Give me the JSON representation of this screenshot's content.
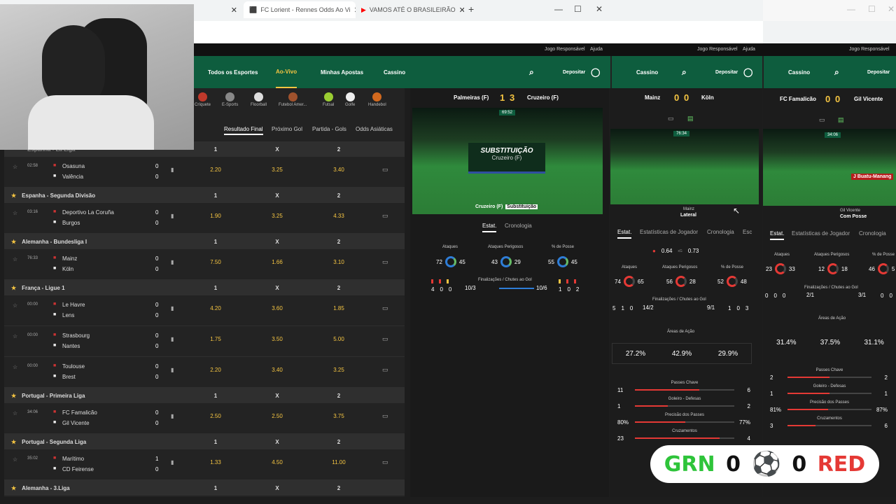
{
  "browser": {
    "tabs": [
      {
        "title": "FC Lorient - Rennes Odds Ao Vi",
        "icon": "betting-site-icon"
      },
      {
        "title": "VAMOS ATÉ O BRASILEIRÃO",
        "icon": "youtube-icon"
      }
    ],
    "new_tab": "+",
    "window_controls": {
      "minimize": "—",
      "maximize": "☐",
      "close": "✕"
    }
  },
  "site": {
    "topbar": [
      "Jogo Responsável",
      "Ajuda"
    ],
    "nav": [
      "Todos os Esportes",
      "Ao-Vivo",
      "Minhas Apostas",
      "Cassino"
    ],
    "deposit": "Depositar",
    "panel2_nav": "Cassino",
    "panel3_nav": "Cassino"
  },
  "sports_bar": [
    "Críquete",
    "E-Sports",
    "Floorball",
    "Futebol Amer...",
    "Futsal",
    "Golfe",
    "Handebol"
  ],
  "market_tabs": [
    "Resultado Final",
    "Próximo Gol",
    "Partida - Gols",
    "Odds Asiáticas"
  ],
  "col_headers": {
    "h": "1",
    "x": "X",
    "a": "2"
  },
  "partial_league": "Espanha - La Liga",
  "rows": [
    {
      "type": "match",
      "time": "02:58",
      "home": "Osasuna",
      "away": "Valência",
      "hs": "0",
      "as": "0",
      "o1": "2.20",
      "ox": "3.25",
      "o2": "3.40"
    },
    {
      "type": "league",
      "name": "Espanha - Segunda Divisão"
    },
    {
      "type": "match",
      "time": "03:16",
      "home": "Deportivo La Coruña",
      "away": "Burgos",
      "hs": "0",
      "as": "0",
      "o1": "1.90",
      "ox": "3.25",
      "o2": "4.33"
    },
    {
      "type": "league",
      "name": "Alemanha - Bundesliga I",
      "star": true
    },
    {
      "type": "match",
      "time": "76:33",
      "home": "Mainz",
      "away": "Köln",
      "hs": "0",
      "as": "0",
      "o1": "7.50",
      "ox": "1.66",
      "o2": "3.10"
    },
    {
      "type": "league",
      "name": "França - Ligue 1",
      "star": true
    },
    {
      "type": "match",
      "time": "00:00",
      "home": "Le Havre",
      "away": "Lens",
      "hs": "0",
      "as": "0",
      "o1": "4.20",
      "ox": "3.60",
      "o2": "1.85"
    },
    {
      "type": "match",
      "time": "00:00",
      "home": "Strasbourg",
      "away": "Nantes",
      "hs": "0",
      "as": "0",
      "o1": "1.75",
      "ox": "3.50",
      "o2": "5.00"
    },
    {
      "type": "match",
      "time": "00:00",
      "home": "Toulouse",
      "away": "Brest",
      "hs": "0",
      "as": "0",
      "o1": "2.20",
      "ox": "3.40",
      "o2": "3.25"
    },
    {
      "type": "league",
      "name": "Portugal - Primeira Liga",
      "star": true
    },
    {
      "type": "match",
      "time": "34:06",
      "home": "FC Famalicão",
      "away": "Gil Vicente",
      "hs": "0",
      "as": "0",
      "o1": "2.50",
      "ox": "2.50",
      "o2": "3.75"
    },
    {
      "type": "league",
      "name": "Portugal - Segunda Liga",
      "star": true
    },
    {
      "type": "match",
      "time": "35:02",
      "home": "Marítimo",
      "away": "CD Feirense",
      "hs": "1",
      "as": "0",
      "o1": "1.33",
      "ox": "4.50",
      "o2": "11.00"
    },
    {
      "type": "league",
      "name": "Alemanha - 3.Liga",
      "star": true
    }
  ],
  "mid": {
    "home": "Palmeiras (F)",
    "away": "Cruzeiro (F)",
    "hs": "1",
    "as": "3",
    "clock": "69:52",
    "event_title": "SUBSTITUIÇÃO",
    "event_team": "Cruzeiro (F)",
    "footer_team": "Cruzeiro (F)",
    "footer_event": "Substituição",
    "tabs": [
      "Estat.",
      "Cronologia"
    ],
    "stat_labels": [
      "Ataques",
      "Ataques Perigosos",
      "% de Posse"
    ],
    "stats": [
      [
        "72",
        "45"
      ],
      [
        "43",
        "29"
      ],
      [
        "55",
        "45"
      ]
    ],
    "shots_label": "Finalizações / Chutes ao Gol",
    "shots": [
      "10/3",
      "10/6"
    ],
    "cards_left": [
      "4",
      "0",
      "0"
    ],
    "cards_right": [
      "1",
      "0",
      "2"
    ]
  },
  "panel2": {
    "home": "Mainz",
    "away": "Köln",
    "hs": "0",
    "as": "0",
    "clock": "76:34",
    "event_team": "Mainz",
    "event_name": "Lateral",
    "tabs": [
      "Estat.",
      "Estatísticas de Jogador",
      "Cronologia",
      "Esc"
    ],
    "xg": [
      "0.64",
      "xG",
      "0.73"
    ],
    "stat_labels": [
      "Ataques",
      "Ataques Perigosos",
      "% de Posse"
    ],
    "stats": [
      [
        "74",
        "65"
      ],
      [
        "56",
        "28"
      ],
      [
        "52",
        "48"
      ]
    ],
    "shots_label": "Finalizações / Chutes ao Gol",
    "shots": [
      "14/2",
      "9/1"
    ],
    "cards_left": [
      "5",
      "1",
      "0"
    ],
    "cards_right": [
      "1",
      "0",
      "3"
    ],
    "areas_label": "Áreas de Ação",
    "areas": [
      "27.2%",
      "42.9%",
      "29.9%"
    ],
    "bars": [
      {
        "label": "Passes Chave",
        "l": "11",
        "r": "6",
        "frac": 0.65
      },
      {
        "label": "Goleiro - Defesas",
        "l": "1",
        "r": "2",
        "frac": 0.33
      },
      {
        "label": "Precisão dos Passes",
        "l": "80%",
        "r": "77%",
        "frac": 0.51
      },
      {
        "label": "Cruzamentos",
        "l": "23",
        "r": "4",
        "frac": 0.85
      }
    ]
  },
  "panel3": {
    "home": "FC Famalicão",
    "away": "Gil Vicente",
    "hs": "0",
    "as": "0",
    "clock": "34:06",
    "event_team": "Gil Vicente",
    "event_name": "Com Posse",
    "player": "J Buatu-Manang",
    "tabs": [
      "Estat.",
      "Estatísticas de Jogador",
      "Cronologia"
    ],
    "stat_labels": [
      "Ataques",
      "Ataques Perigosos",
      "% de Posse"
    ],
    "stats": [
      [
        "23",
        "33"
      ],
      [
        "12",
        "18"
      ],
      [
        "46",
        "5"
      ]
    ],
    "shots_label": "Finalizações / Chutes ao Gol",
    "shots": [
      "2/1",
      "3/1"
    ],
    "cards_left": [
      "0",
      "0",
      "0"
    ],
    "cards_right": [
      "0",
      "0"
    ],
    "areas_label": "Áreas de Ação",
    "areas": [
      "31.4%",
      "37.5%",
      "31.1%"
    ],
    "bars": [
      {
        "label": "Passes Chave",
        "l": "2",
        "r": "2",
        "frac": 0.5
      },
      {
        "label": "Goleiro - Defesas",
        "l": "1",
        "r": "1",
        "frac": 0.5
      },
      {
        "label": "Precisão dos Passes",
        "l": "81%",
        "r": "87%",
        "frac": 0.48
      },
      {
        "label": "Cruzamentos",
        "l": "3",
        "r": "6",
        "frac": 0.33
      }
    ]
  },
  "banner": {
    "left": "GRN",
    "ls": "0",
    "rs": "0",
    "right": "RED"
  },
  "colors": {
    "odds": "#f5c542",
    "brand": "#0e5d3e",
    "accent_red": "#e53935"
  }
}
